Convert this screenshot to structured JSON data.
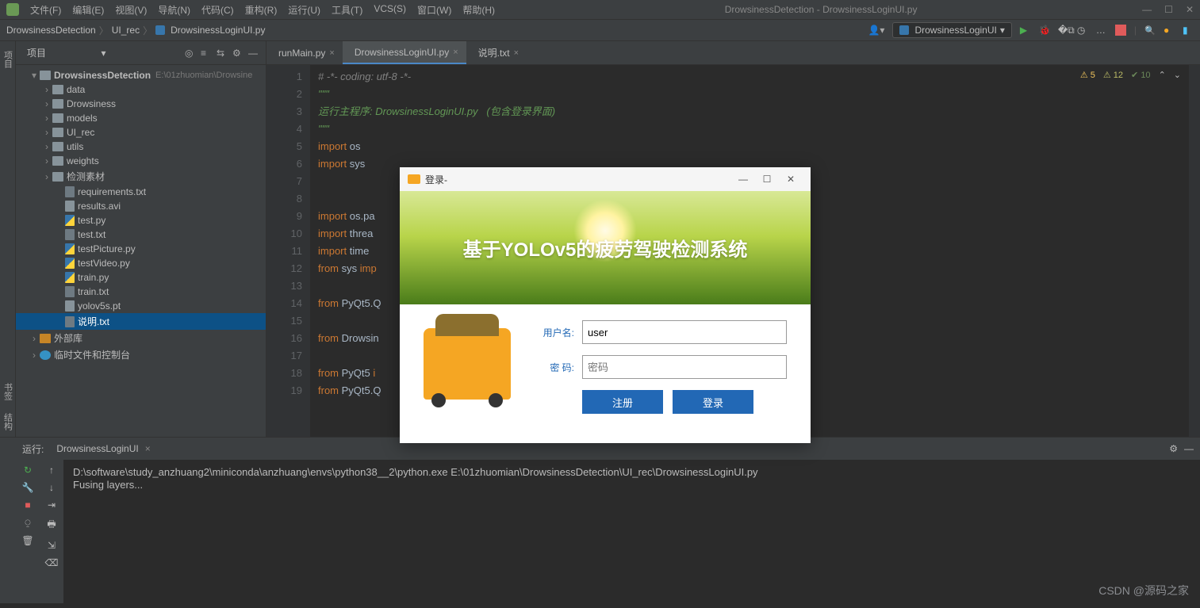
{
  "window": {
    "menus": [
      "文件(F)",
      "编辑(E)",
      "视图(V)",
      "导航(N)",
      "代码(C)",
      "重构(R)",
      "运行(U)",
      "工具(T)",
      "VCS(S)",
      "窗口(W)",
      "帮助(H)"
    ],
    "title": "DrowsinessDetection - DrowsinessLoginUI.py"
  },
  "breadcrumb": {
    "seg1": "DrowsinessDetection",
    "seg2": "UI_rec",
    "seg3": "DrowsinessLoginUI.py"
  },
  "run_config": "DrowsinessLoginUI",
  "project_panel": {
    "title": "项目",
    "root_name": "DrowsinessDetection",
    "root_path": "E:\\01zhuomian\\Drowsine",
    "folders": [
      "data",
      "Drowsiness",
      "models",
      "UI_rec",
      "utils",
      "weights",
      "检测素材"
    ],
    "files": [
      {
        "name": "requirements.txt",
        "type": "txt"
      },
      {
        "name": "results.avi",
        "type": "media"
      },
      {
        "name": "test.py",
        "type": "py"
      },
      {
        "name": "test.txt",
        "type": "txt"
      },
      {
        "name": "testPicture.py",
        "type": "py"
      },
      {
        "name": "testVideo.py",
        "type": "py"
      },
      {
        "name": "train.py",
        "type": "py"
      },
      {
        "name": "train.txt",
        "type": "txt"
      },
      {
        "name": "yolov5s.pt",
        "type": "data"
      },
      {
        "name": "说明.txt",
        "type": "txt",
        "selected": true
      }
    ],
    "external_lib": "外部库",
    "scratches": "临时文件和控制台"
  },
  "editor": {
    "tabs": [
      {
        "name": "runMain.py",
        "active": false
      },
      {
        "name": "DrowsinessLoginUI.py",
        "active": true
      },
      {
        "name": "说明.txt",
        "active": false
      }
    ],
    "badges": {
      "warn": "5",
      "weak": "12",
      "typo": "10"
    },
    "lines": [
      {
        "n": "1",
        "html": "<span class='c-comment'># -*- coding: utf-8 -*-</span>"
      },
      {
        "n": "2",
        "html": "<span class='c-docstring'>\"\"\"</span>"
      },
      {
        "n": "3",
        "html": "<span class='c-docstring'>运行主程序: DrowsinessLoginUI.py   (包含登录界面)</span>"
      },
      {
        "n": "4",
        "html": "<span class='c-docstring'>\"\"\"</span>"
      },
      {
        "n": "5",
        "html": "<span class='c-keyword'>import</span> <span class='c-ident'>os</span>"
      },
      {
        "n": "6",
        "html": "<span class='c-keyword'>import</span> <span class='c-ident'>sys</span>"
      },
      {
        "n": "7",
        "html": ""
      },
      {
        "n": "8",
        "html": ""
      },
      {
        "n": "9",
        "html": "<span class='c-keyword'>import</span> <span class='c-ident'>os.pa</span>"
      },
      {
        "n": "10",
        "html": "<span class='c-keyword'>import</span> <span class='c-ident'>threa</span>"
      },
      {
        "n": "11",
        "html": "<span class='c-keyword'>import</span> <span class='c-ident'>time</span>"
      },
      {
        "n": "12",
        "html": "<span class='c-keyword'>from</span> <span class='c-ident'>sys</span> <span class='c-keyword'>imp</span>"
      },
      {
        "n": "13",
        "html": ""
      },
      {
        "n": "14",
        "html": "<span class='c-keyword'>from</span> <span class='c-ident'>PyQt5.Q</span>"
      },
      {
        "n": "15",
        "html": ""
      },
      {
        "n": "16",
        "html": "<span class='c-keyword'>from</span> <span class='c-ident'>Drowsin</span>"
      },
      {
        "n": "17",
        "html": ""
      },
      {
        "n": "18",
        "html": "<span class='c-keyword'>from</span> <span class='c-ident'>PyQt5</span> <span class='c-keyword'>i</span>"
      },
      {
        "n": "19",
        "html": "<span class='c-keyword'>from</span> <span class='c-ident'>PyQt5.Q</span>"
      }
    ]
  },
  "run_panel": {
    "label": "运行:",
    "config": "DrowsinessLoginUI",
    "output_line1": "D:\\software\\study_anzhuang2\\miniconda\\anzhuang\\envs\\python38__2\\python.exe E:\\01zhuomian\\DrowsinessDetection\\UI_rec\\DrowsinessLoginUI.py",
    "output_line2": "Fusing layers..."
  },
  "dialog": {
    "title": "登录-",
    "banner_title": "基于YOLOv5的疲劳驾驶检测系统",
    "username_label": "用户名:",
    "username_value": "user",
    "password_label": "密  码:",
    "password_placeholder": "密码",
    "btn_register": "注册",
    "btn_login": "登录"
  },
  "watermark": "CSDN @源码之家"
}
